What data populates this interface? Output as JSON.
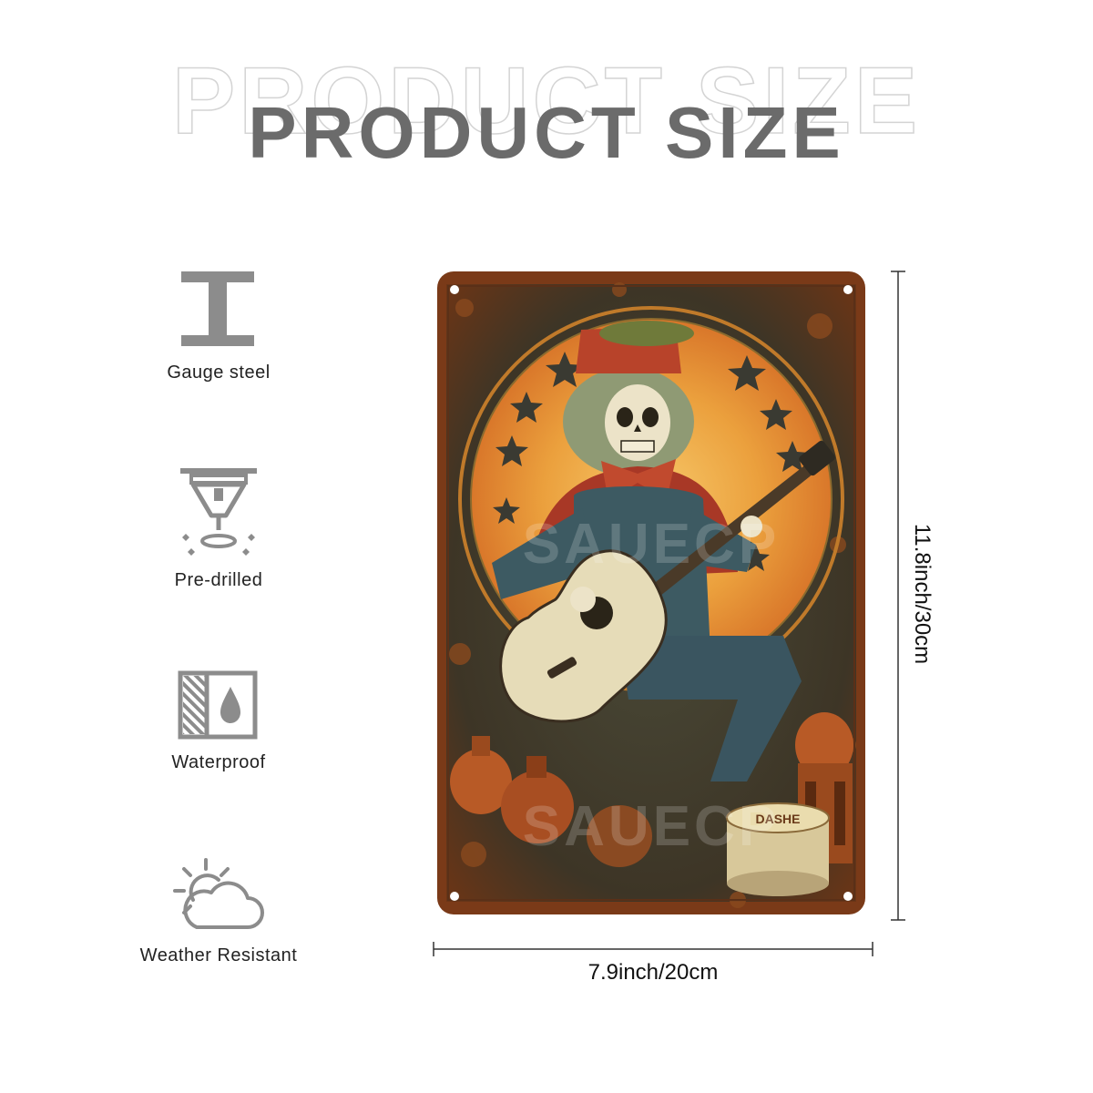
{
  "title": {
    "ghost_text": "PRODUCT SIZE",
    "main_text": "PRODUCT SIZE"
  },
  "features": [
    {
      "icon": "gauge-steel-icon",
      "label": "Gauge steel"
    },
    {
      "icon": "pre-drilled-icon",
      "label": "Pre-drilled"
    },
    {
      "icon": "waterproof-icon",
      "label": "Waterproof"
    },
    {
      "icon": "weather-resistant-icon",
      "label": "Weather Resistant"
    }
  ],
  "dimensions": {
    "height_label": "11.8inch/30cm",
    "width_label": "7.9inch/20cm"
  },
  "sign": {
    "image": "skeleton-guitarist-illustration",
    "watermark": "SAUECP",
    "drum_text": "DASHE"
  },
  "colors": {
    "title": "#6b6b6b",
    "icon": "#8c8c8c",
    "rust": "#7a3a18",
    "sun": "#e8922e"
  }
}
